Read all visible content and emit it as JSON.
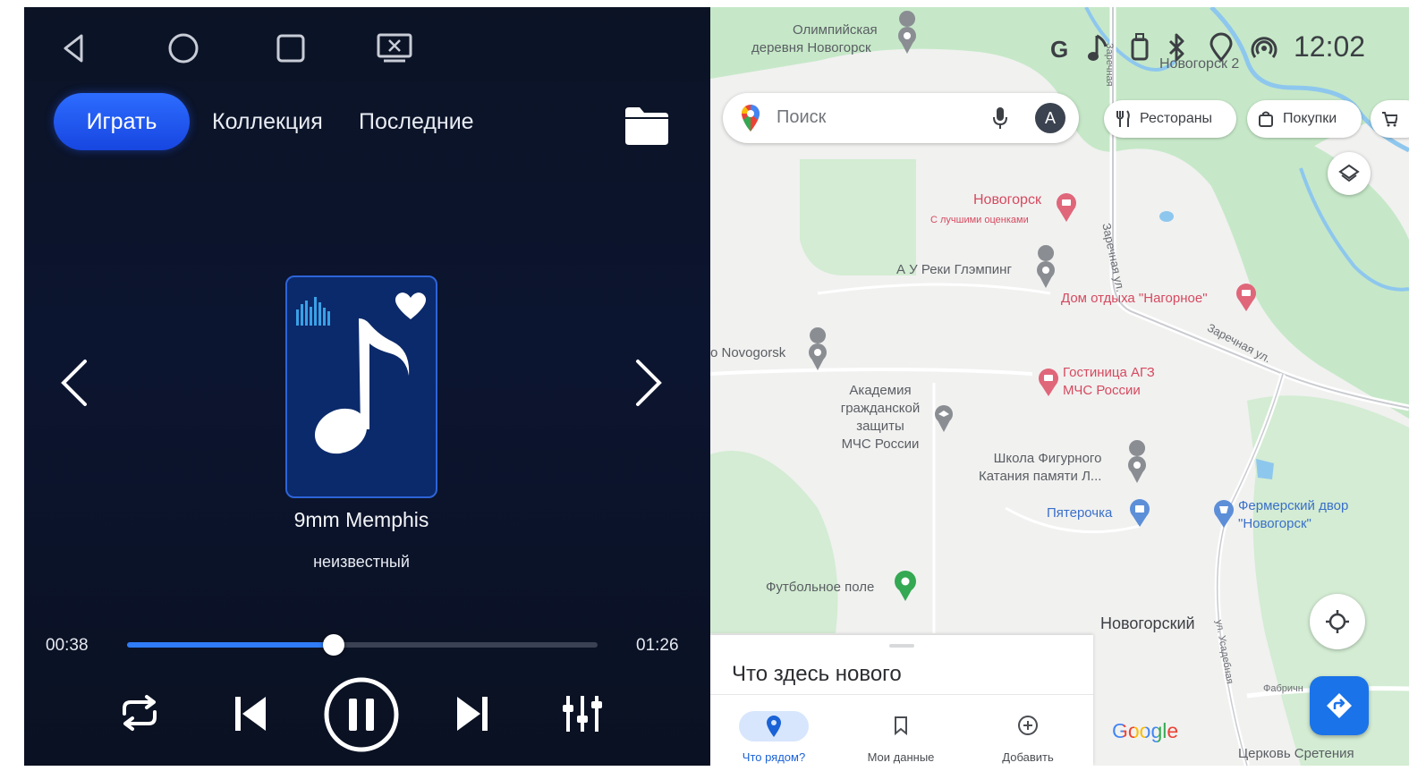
{
  "player": {
    "tabs": {
      "play": "Играть",
      "collection": "Коллекция",
      "recent": "Последние"
    },
    "track": {
      "title": "9mm Memphis",
      "artist": "неизвестный"
    },
    "time": {
      "elapsed": "00:38",
      "total": "01:26"
    },
    "progress_fraction": 0.44,
    "accent_color": "#2f7cf6",
    "icons": [
      "back-triangle-icon",
      "home-circle-icon",
      "recents-square-icon",
      "screen-mirror-icon",
      "folder-icon",
      "chevron-left-icon",
      "chevron-right-icon",
      "music-note-icon",
      "heart-icon",
      "equalizer-bars-icon",
      "repeat-icon",
      "skip-previous-icon",
      "pause-icon",
      "skip-next-icon",
      "equalizer-settings-icon"
    ]
  },
  "maps": {
    "status": {
      "time": "12:02",
      "g_label": "G"
    },
    "search": {
      "placeholder": "Поиск",
      "avatar_letter": "A"
    },
    "chips": {
      "restaurants": "Рестораны",
      "shopping": "Покупки"
    },
    "pois": {
      "olympic_line1": "Олимпийская",
      "olympic_line2": "деревня Новогорск",
      "novogorsk2": "Новогорск 2",
      "novogorsk_hotel": "Новогорск",
      "novogorsk_hotel_sub": "С лучшими оценками",
      "glamping": "А У Реки Глэмпинг",
      "nagornoe": "Дом отдыха \"Нагорное\"",
      "novogorsk_en": "o Novogorsk",
      "agz_line1": "Гостиница АГЗ",
      "agz_line2": "МЧС России",
      "academy_line1": "Академия",
      "academy_line2": "гражданской",
      "academy_line3": "защиты",
      "academy_line4": "МЧС России",
      "skating_line1": "Школа Фигурного",
      "skating_line2": "Катания памяти Л...",
      "pyaterochka": "Пятерочка",
      "farm_line1": "Фермерский двор",
      "farm_line2": "\"Новогорск\"",
      "football": "Футбольное поле",
      "novogorsky": "Новогорский",
      "church": "Церковь Сретения"
    },
    "streets": {
      "zarechnaya_a": "Заречная ул.",
      "zarechnaya_b": "Заречная ул.",
      "zarechnaya_c": "Заречная",
      "usadebnaya": "ул. Усадебная",
      "fabrichnaya": "Фабричн"
    },
    "sheet": {
      "title": "Что здесь нового",
      "nav": {
        "nearby": "Что рядом?",
        "saved": "Мои данные",
        "add": "Добавить"
      }
    },
    "google_logo": "Google",
    "colors": {
      "map_bg": "#f1f1f0",
      "park_green": "#c6e8c8",
      "water": "#8ec7ee",
      "brand_blue": "#1a73e8"
    }
  }
}
